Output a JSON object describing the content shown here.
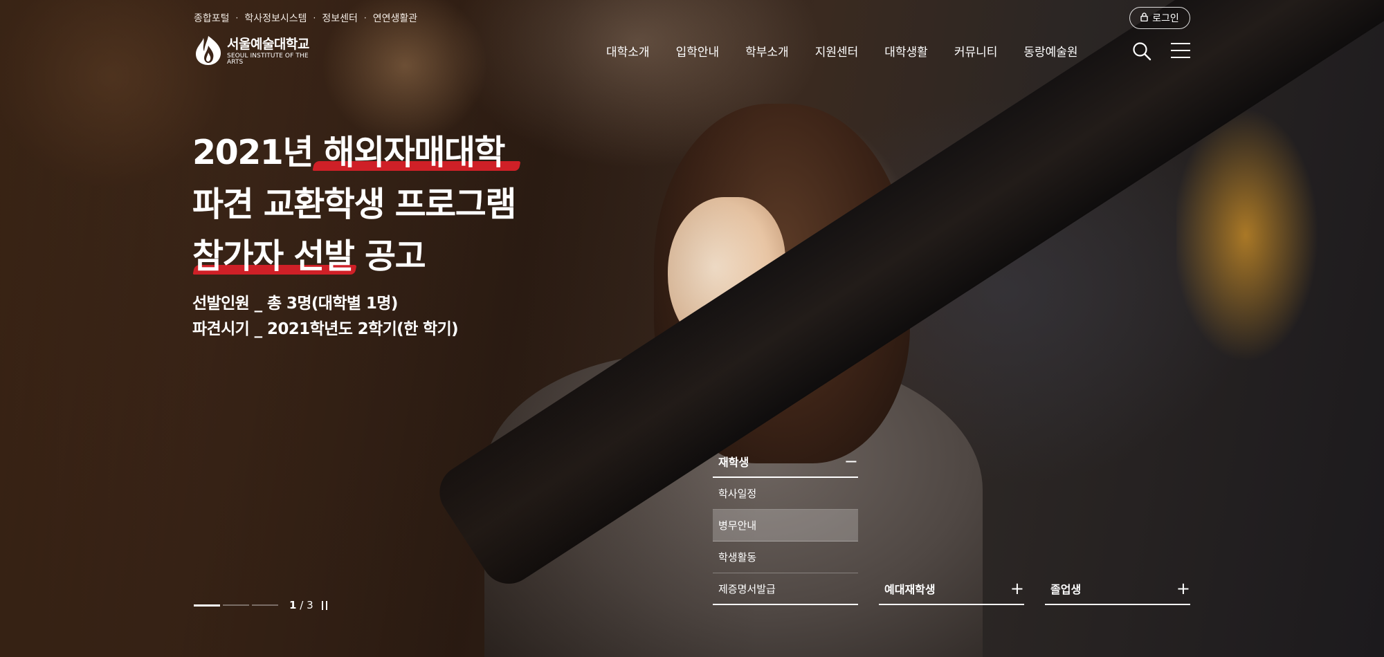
{
  "utility_links": [
    "종합포털",
    "학사정보시스템",
    "정보센터",
    "연연생활관"
  ],
  "utility_separator": "·",
  "login": {
    "label": "로그인",
    "icon": "lock-icon"
  },
  "logo": {
    "name_ko": "서울예술대학교",
    "name_en": "SEOUL INSTITUTE OF THE ARTS",
    "icon": "flame-emblem-icon"
  },
  "gnb": [
    "대학소개",
    "입학안내",
    "학부소개",
    "지원센터",
    "대학생활",
    "커뮤니티",
    "동랑예술원"
  ],
  "header_icons": {
    "search": "search-icon",
    "menu": "hamburger-menu-icon"
  },
  "hero": {
    "headline": [
      "2021년 해외자매대학",
      "파견 교환학생 프로그램",
      "참가자 선발 공고"
    ],
    "highlight_color": "#cf2027",
    "sub": [
      "선발인원 _  총 3명(대학별 1명)",
      "파견시기 _  2021학년도 2학기(한 학기)"
    ]
  },
  "quick_menu": [
    {
      "title": "재학생",
      "toggle": "−",
      "expanded": true,
      "items": [
        "학사일정",
        "병무안내",
        "학생활동",
        "제증명서발급"
      ],
      "active_item": "병무안내"
    },
    {
      "title": "예대재학생",
      "toggle": "+",
      "expanded": false
    },
    {
      "title": "졸업생",
      "toggle": "+",
      "expanded": false
    }
  ],
  "slider": {
    "current": "1",
    "separator": "/",
    "total": "3",
    "pause_icon": "pause-icon"
  }
}
